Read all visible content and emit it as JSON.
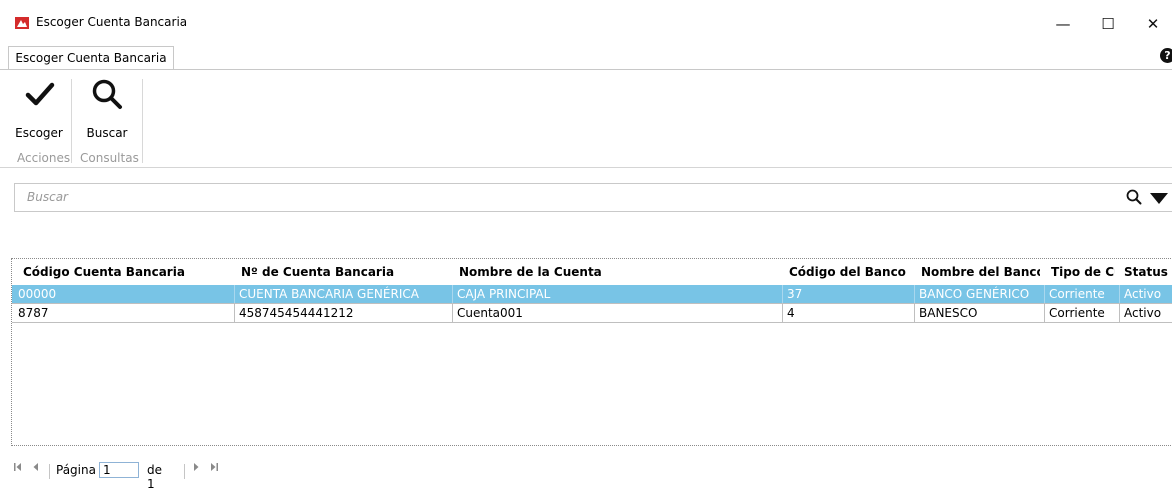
{
  "window": {
    "title": "Escoger Cuenta Bancaria",
    "minimize_glyph": "—",
    "maximize_glyph": "☐",
    "close_glyph": "✕"
  },
  "ribbon": {
    "tab_label": "Escoger Cuenta Bancaria",
    "buttons": [
      {
        "label": "Escoger",
        "icon": "checkmark-icon"
      },
      {
        "label": "Buscar",
        "icon": "search-icon"
      }
    ],
    "groups": [
      "Acciones",
      "Consultas"
    ],
    "help_glyph": "?"
  },
  "search": {
    "placeholder": "Buscar"
  },
  "grid": {
    "columns": [
      "Código Cuenta Bancaria",
      "Nº de Cuenta Bancaria",
      "Nombre de la Cuenta",
      "Código del Banco",
      "Nombre del Banco",
      "Tipo de Cu",
      "Status"
    ],
    "rows": [
      [
        "00000",
        "CUENTA BANCARIA GENÉRICA",
        "CAJA PRINCIPAL",
        "37",
        "BANCO GENÉRICO",
        "Corriente",
        "Activo"
      ],
      [
        "8787",
        "458745454441212",
        "Cuenta001",
        "4",
        "BANESCO",
        "Corriente",
        "Activo"
      ]
    ],
    "selected_row": 0
  },
  "pager": {
    "page_label": "Página",
    "page_value": "1",
    "of_label": "de 1"
  },
  "colors": {
    "selection": "#78c4e6",
    "app_icon": "#d42b2b"
  }
}
